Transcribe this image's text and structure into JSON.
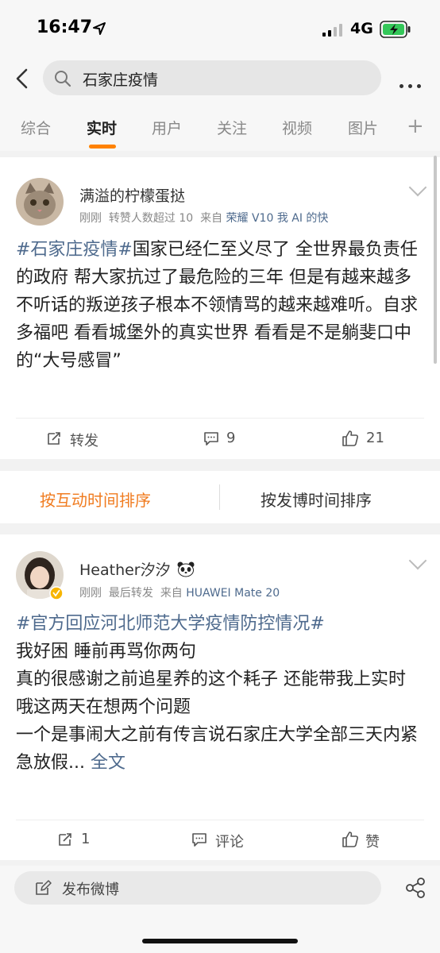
{
  "status_bar": {
    "time": "16:47",
    "network": "4G"
  },
  "search": {
    "query": "石家庄疫情"
  },
  "tabs": [
    {
      "label": "综合",
      "active": false
    },
    {
      "label": "实时",
      "active": true
    },
    {
      "label": "用户",
      "active": false
    },
    {
      "label": "关注",
      "active": false
    },
    {
      "label": "视频",
      "active": false
    },
    {
      "label": "图片",
      "active": false
    }
  ],
  "tabs_more": "+",
  "post1": {
    "username": "满溢的柠檬蛋挞",
    "meta_time": "刚刚",
    "meta_note": "转赞人数超过 10",
    "meta_from": "来自",
    "meta_source": "荣耀 V10 我 AI 的快",
    "hashtag": "#石家庄疫情#",
    "text": "国家已经仁至义尽了  全世界最负责任的政府 帮大家抗过了最危险的三年 但是有越来越多不听话的叛逆孩子根本不领情骂的越来越难听。自求多福吧  看看城堡外的真实世界  看看是不是躺斐口中的“大号感冒”",
    "repost_label": "转发",
    "comments": "9",
    "likes": "21"
  },
  "sort": {
    "by_interaction": "按互动时间排序",
    "by_post_time": "按发博时间排序"
  },
  "post2": {
    "username": "Heather汐汐",
    "meta_time": "刚刚",
    "meta_note": "最后转发",
    "meta_from": "来自",
    "meta_source": "HUAWEI Mate 20",
    "hashtag": "#官方回应河北师范大学疫情防控情况#",
    "lines": [
      "我好困 睡前再骂你两句",
      "真的很感谢之前追星养的这个耗子 还能带我上实时",
      "哦这两天在想两个问题",
      "一个是事闹大之前有传言说石家庄大学全部三天内紧急放假..."
    ],
    "full_text_link": "全文",
    "reposts": "1",
    "comment_label": "评论",
    "like_label": "赞"
  },
  "compose": {
    "placeholder": "发布微博"
  },
  "colors": {
    "accent": "#ff8200",
    "link": "#4e6a8d"
  }
}
